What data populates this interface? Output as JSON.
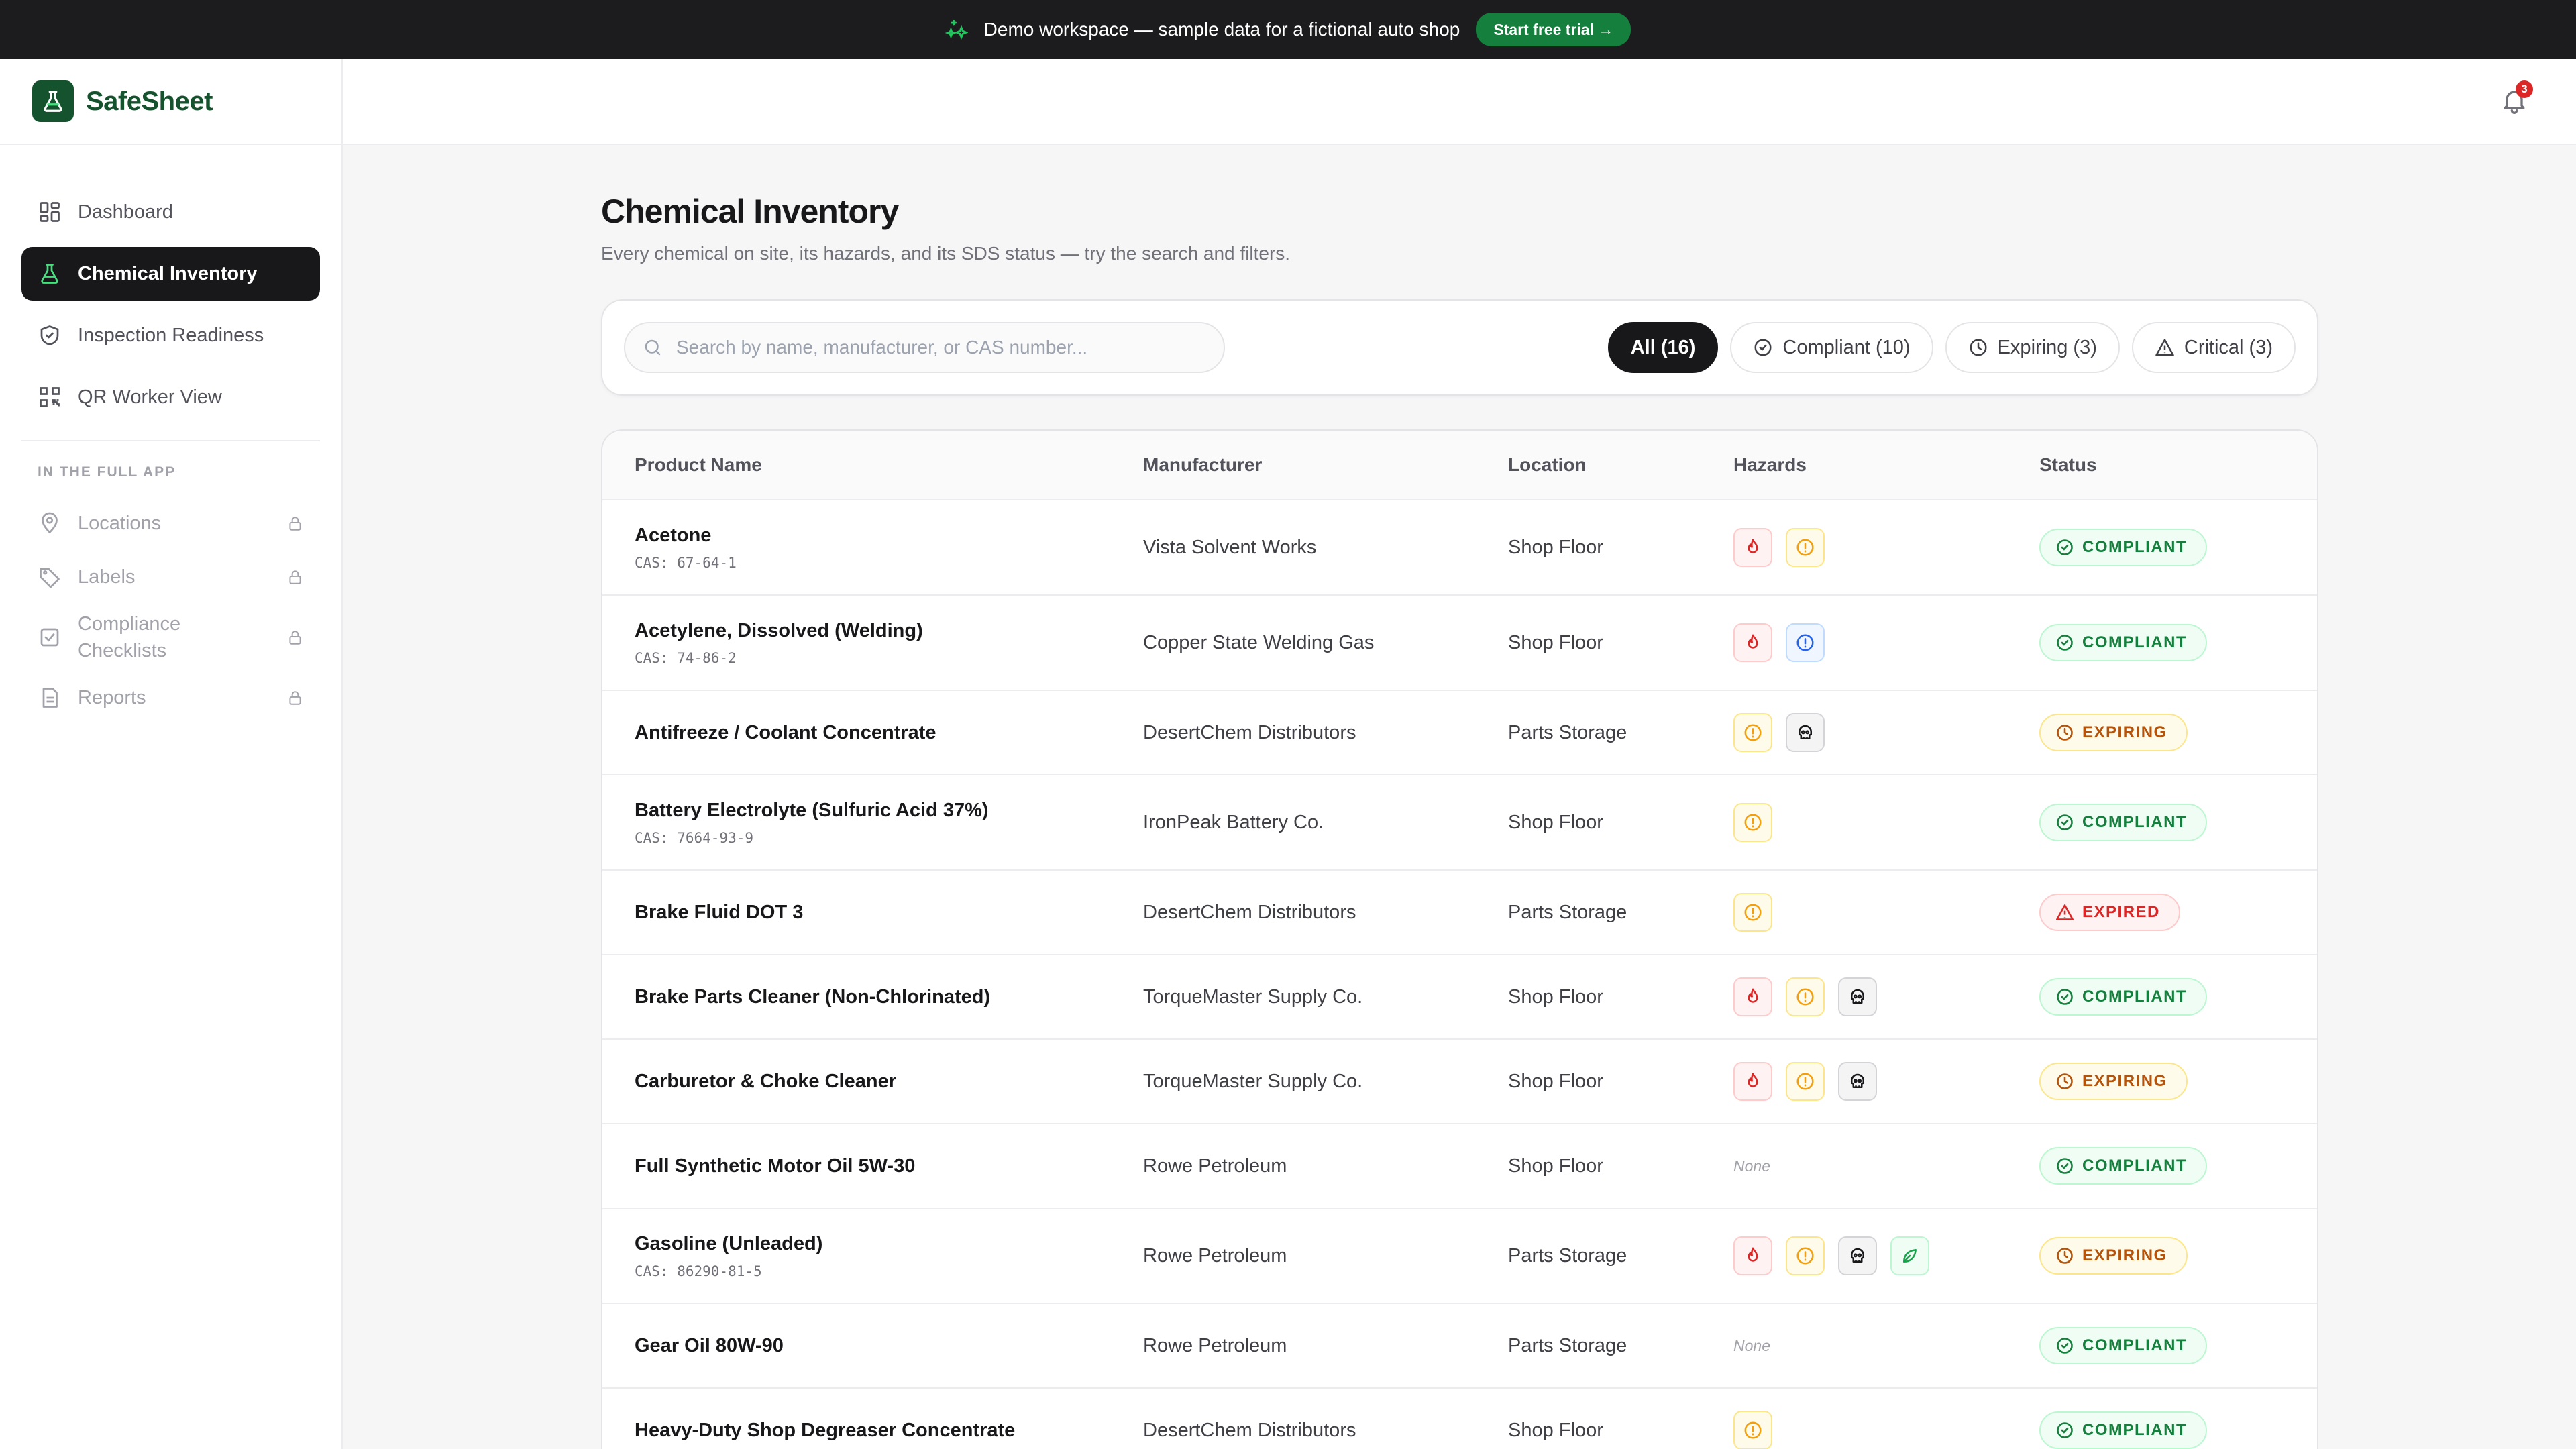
{
  "banner": {
    "message": "Demo workspace — sample data for a fictional auto shop",
    "cta": "Start free trial →"
  },
  "brand": {
    "name": "SafeSheet"
  },
  "nav": {
    "items": [
      {
        "label": "Dashboard",
        "icon": "grid-icon",
        "active": false
      },
      {
        "label": "Chemical Inventory",
        "icon": "flask-icon",
        "active": true
      },
      {
        "label": "Inspection Readiness",
        "icon": "shield-icon",
        "active": false
      },
      {
        "label": "QR Worker View",
        "icon": "qr-icon",
        "active": false
      }
    ],
    "section_label": "IN THE FULL APP",
    "locked_items": [
      {
        "label": "Locations",
        "icon": "pin-icon"
      },
      {
        "label": "Labels",
        "icon": "tag-icon"
      },
      {
        "label": "Compliance Checklists",
        "icon": "checklist-icon"
      },
      {
        "label": "Reports",
        "icon": "report-icon"
      }
    ]
  },
  "header": {
    "notification_count": "3"
  },
  "page": {
    "title": "Chemical Inventory",
    "subtitle": "Every chemical on site, its hazards, and its SDS status — try the search and filters."
  },
  "search": {
    "placeholder": "Search by name, manufacturer, or CAS number...",
    "value": ""
  },
  "filters": [
    {
      "label": "All (16)",
      "active": true,
      "icon": ""
    },
    {
      "label": "Compliant (10)",
      "active": false,
      "icon": "check-circle-icon"
    },
    {
      "label": "Expiring (3)",
      "active": false,
      "icon": "clock-icon"
    },
    {
      "label": "Critical (3)",
      "active": false,
      "icon": "warning-icon"
    }
  ],
  "table": {
    "columns": [
      "Product Name",
      "Manufacturer",
      "Location",
      "Hazards",
      "Status"
    ],
    "none_label": "None",
    "rows": [
      {
        "name": "Acetone",
        "cas": "CAS: 67-64-1",
        "manufacturer": "Vista Solvent Works",
        "location": "Shop Floor",
        "hazards": [
          "flame",
          "warn"
        ],
        "status": "COMPLIANT"
      },
      {
        "name": "Acetylene, Dissolved (Welding)",
        "cas": "CAS: 74-86-2",
        "manufacturer": "Copper State Welding Gas",
        "location": "Shop Floor",
        "hazards": [
          "flame",
          "info"
        ],
        "status": "COMPLIANT"
      },
      {
        "name": "Antifreeze / Coolant Concentrate",
        "cas": "",
        "manufacturer": "DesertChem Distributors",
        "location": "Parts Storage",
        "hazards": [
          "warn",
          "tox"
        ],
        "status": "EXPIRING"
      },
      {
        "name": "Battery Electrolyte (Sulfuric Acid 37%)",
        "cas": "CAS: 7664-93-9",
        "manufacturer": "IronPeak Battery Co.",
        "location": "Shop Floor",
        "hazards": [
          "warn"
        ],
        "status": "COMPLIANT"
      },
      {
        "name": "Brake Fluid DOT 3",
        "cas": "",
        "manufacturer": "DesertChem Distributors",
        "location": "Parts Storage",
        "hazards": [
          "warn"
        ],
        "status": "EXPIRED"
      },
      {
        "name": "Brake Parts Cleaner (Non-Chlorinated)",
        "cas": "",
        "manufacturer": "TorqueMaster Supply Co.",
        "location": "Shop Floor",
        "hazards": [
          "flame",
          "warn",
          "tox"
        ],
        "status": "COMPLIANT"
      },
      {
        "name": "Carburetor & Choke Cleaner",
        "cas": "",
        "manufacturer": "TorqueMaster Supply Co.",
        "location": "Shop Floor",
        "hazards": [
          "flame",
          "warn",
          "tox"
        ],
        "status": "EXPIRING"
      },
      {
        "name": "Full Synthetic Motor Oil 5W-30",
        "cas": "",
        "manufacturer": "Rowe Petroleum",
        "location": "Shop Floor",
        "hazards": [],
        "status": "COMPLIANT"
      },
      {
        "name": "Gasoline (Unleaded)",
        "cas": "CAS: 86290-81-5",
        "manufacturer": "Rowe Petroleum",
        "location": "Parts Storage",
        "hazards": [
          "flame",
          "warn",
          "tox",
          "env"
        ],
        "status": "EXPIRING"
      },
      {
        "name": "Gear Oil 80W-90",
        "cas": "",
        "manufacturer": "Rowe Petroleum",
        "location": "Parts Storage",
        "hazards": [],
        "status": "COMPLIANT"
      },
      {
        "name": "Heavy-Duty Shop Degreaser Concentrate",
        "cas": "",
        "manufacturer": "DesertChem Distributors",
        "location": "Shop Floor",
        "hazards": [
          "warn"
        ],
        "status": "COMPLIANT"
      }
    ]
  }
}
